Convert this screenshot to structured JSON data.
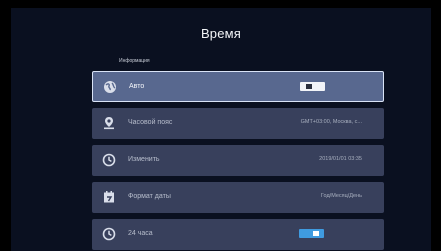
{
  "screen": {
    "title": "Время"
  },
  "section": {
    "label": "Информация"
  },
  "rows": [
    {
      "label": "Авто",
      "icon": "globe-icon",
      "toggle": "off"
    },
    {
      "label": "Часовой пояс",
      "icon": "location-pin-icon",
      "value": "GMT+03:00, Москва, с..."
    },
    {
      "label": "Изменить",
      "icon": "clock-icon",
      "value": "2019/01/01 03:35"
    },
    {
      "label": "Формат даты",
      "icon": "calendar-icon",
      "value": "Год/Месяц/День"
    },
    {
      "label": "24 часа",
      "icon": "clock-icon",
      "toggle": "on"
    }
  ],
  "colors": {
    "background": "#0a1020",
    "row": "#38405c",
    "row_active": "#58688f",
    "toggle_on": "#3f9be0"
  }
}
